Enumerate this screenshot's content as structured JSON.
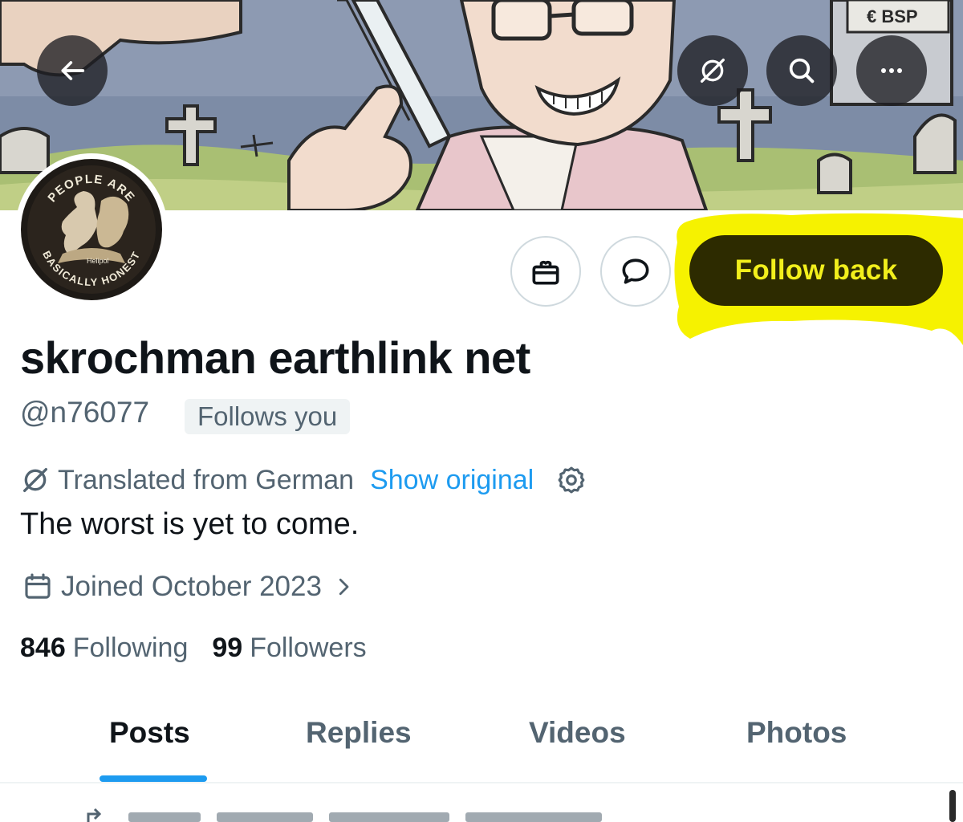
{
  "banner": {
    "artwork_description": "cartoon-banner-artwork",
    "sign_text": "€ BSP"
  },
  "avatar": {
    "top_text": "PEOPLE ARE",
    "bottom_text": "BASICALLY HONEST",
    "center_text": "Helipol"
  },
  "highlight_color": "#f6f200",
  "actions": {
    "follow_label": "Follow back",
    "follow_bg": "#2d2b00",
    "follow_text_color": "#f2ef1c"
  },
  "profile": {
    "name": "skrochman earthlink net",
    "handle": "@n76077",
    "follows_badge": "Follows you",
    "translated_text": "Translated from German",
    "show_original": "Show original",
    "bio": "The worst is yet to come.",
    "joined": "Joined October 2023"
  },
  "stats": {
    "following_count": "846",
    "following_label": "Following",
    "followers_count": "99",
    "followers_label": "Followers"
  },
  "tabs": [
    {
      "label": "Posts",
      "active": true
    },
    {
      "label": "Replies",
      "active": false
    },
    {
      "label": "Videos",
      "active": false
    },
    {
      "label": "Photos",
      "active": false
    }
  ],
  "colors": {
    "accent": "#1d9bf0",
    "secondary_text": "#536471",
    "primary_text": "#0f1419"
  },
  "icons": [
    "back-arrow-icon",
    "translate-icon",
    "search-icon",
    "more-icon",
    "gift-icon",
    "message-icon",
    "gear-icon",
    "calendar-icon",
    "chevron-right-icon",
    "repost-icon"
  ]
}
